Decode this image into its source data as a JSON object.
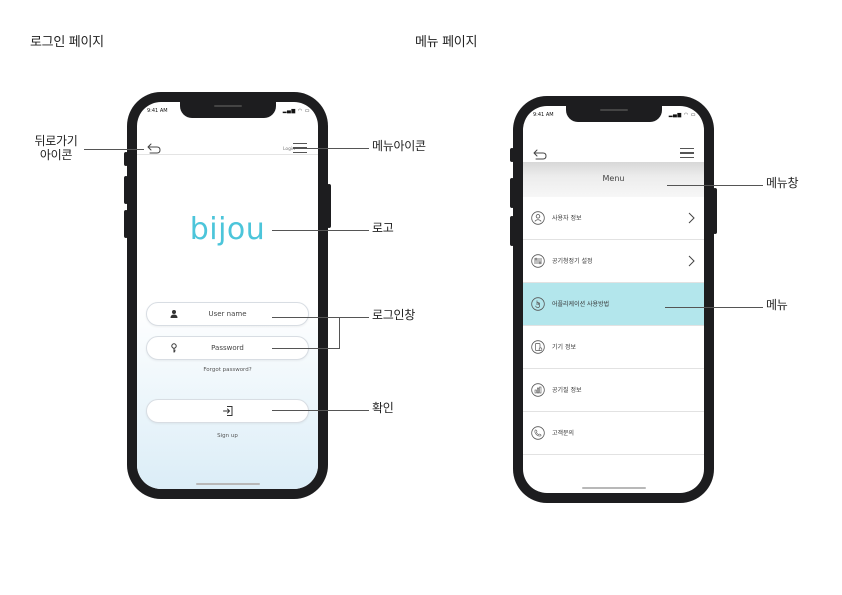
{
  "sections": {
    "login_title": "로그인 페이지",
    "menu_title": "메뉴 페이지"
  },
  "status_bar": {
    "time": "9:41 AM",
    "icons": "▂▄▆ ◠ ▭"
  },
  "login_screen": {
    "login_link": "Login",
    "logo_text": "bijou",
    "username_placeholder": "User name",
    "password_placeholder": "Password",
    "forgot_password": "Forgot password?",
    "sign_up": "Sign up"
  },
  "menu_screen": {
    "menu_header": "Menu",
    "items": [
      {
        "label": "사용자 정보",
        "icon": "user-icon",
        "chevron": true
      },
      {
        "label": "공기청정기 설정",
        "icon": "purifier-settings-icon",
        "chevron": true
      },
      {
        "label": "어플리케이션 사용방법",
        "icon": "app-guide-icon",
        "active": true
      },
      {
        "label": "기기 정보",
        "icon": "device-info-icon"
      },
      {
        "label": "공기질 정보",
        "icon": "air-quality-icon"
      },
      {
        "label": "고객문의",
        "icon": "customer-support-icon"
      }
    ],
    "active_color": "#b3e6ec"
  },
  "annotations": {
    "back_icon": "뒤로가기\n아이콘",
    "menu_icon": "메뉴아이콘",
    "logo": "로고",
    "login_form": "로그인창",
    "confirm": "확인",
    "menu_window": "메뉴창",
    "menu": "메뉴"
  },
  "colors": {
    "brand": "#4cc5da",
    "phone_frame": "#1d1d1f"
  }
}
